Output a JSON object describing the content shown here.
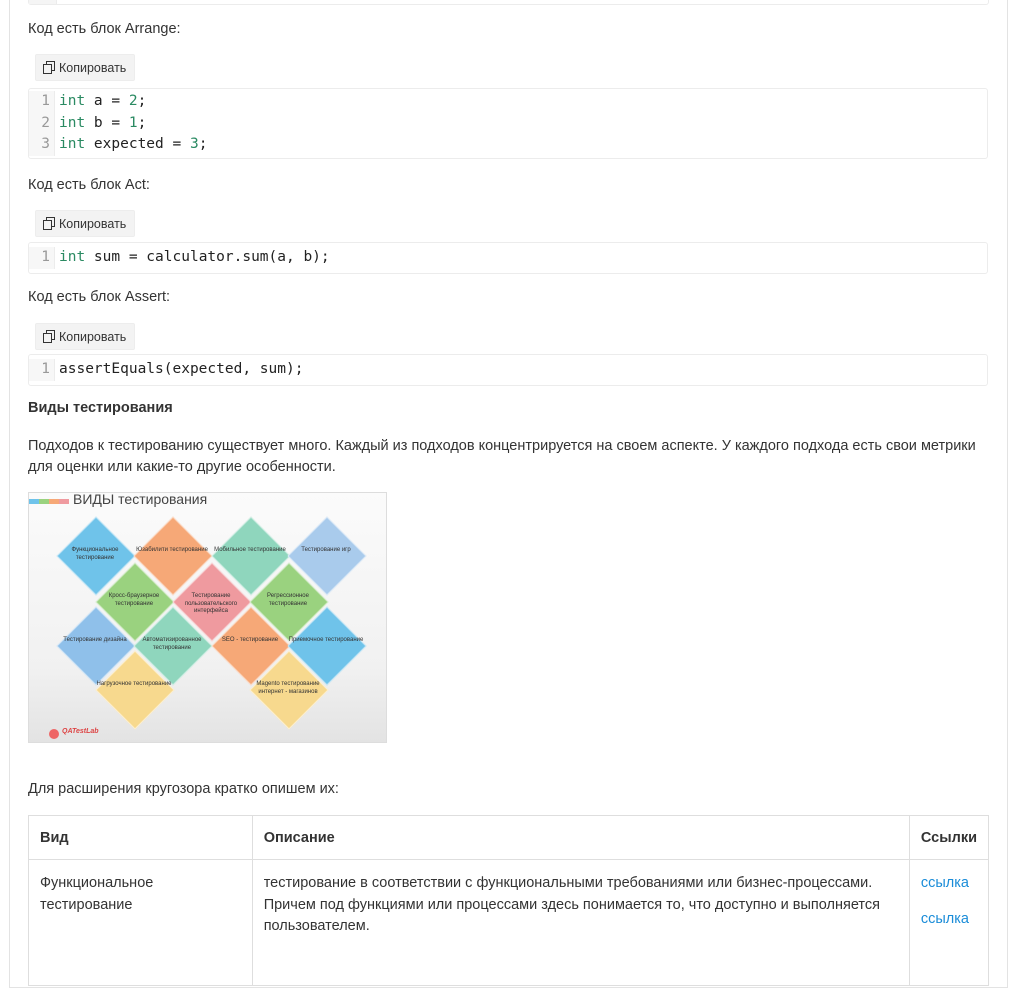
{
  "labels": {
    "arrange": "Код есть блок Arrange:",
    "act": "Код есть блок Act:",
    "assert": "Код есть блок Assert:",
    "copy": "Копировать"
  },
  "code_arrange": [
    {
      "n": "1",
      "kw": "int",
      "rest": " a = ",
      "num": "2",
      "end": ";"
    },
    {
      "n": "2",
      "kw": "int",
      "rest": " b = ",
      "num": "1",
      "end": ";"
    },
    {
      "n": "3",
      "kw": "int",
      "rest": " expected = ",
      "num": "3",
      "end": ";"
    }
  ],
  "code_act": [
    {
      "n": "1",
      "kw": "int",
      "rest": " sum = calculator.sum(a, b);"
    }
  ],
  "code_assert": [
    {
      "n": "1",
      "rest": "assertEquals(expected, sum);"
    }
  ],
  "section": {
    "heading": "Виды тестирования",
    "intro": "Подходов к тестированию существует много. Каждый из подходов концентрируется на своем аспекте. У каждого подхода есть свои метрики для оценки или какие-то другие особенности.",
    "outro": "Для расширения кругозора кратко опишем их:"
  },
  "image": {
    "title": "ВИДЫ тестирования",
    "logo": "QATestLab",
    "tiles": [
      "Функциональное тестирование",
      "Юзабилити тестирование",
      "Мобильное тестирование",
      "Тестирование игр",
      "Кросс-браузерное тестирование",
      "Тестирование пользовательского интерфейса",
      "Регрессионное тестирование",
      "Тестирование дизайна",
      "Автоматизированное тестирование",
      "SEO - тестирование",
      "Приемочное тестирование",
      "Нагрузочное тестирование",
      "Magento тестирование интернет - магазинов"
    ],
    "colors": [
      "#6fc3ea",
      "#f6a877",
      "#8fd6bd",
      "#a9cbec",
      "#9ad27f",
      "#ef9a9f",
      "#9ad27f",
      "#8fc0ea",
      "#8fd6bd",
      "#f6a877",
      "#6fc3ea",
      "#f7d98e",
      "#f7d98e"
    ]
  },
  "table": {
    "headers": [
      "Вид",
      "Описание",
      "Ссылки"
    ],
    "rows": [
      {
        "type": "Функциональное тестирование",
        "desc": "тестирование в соответствии с функциональными требованиями или бизнес-процессами. Причем под функциями или процессами здесь понимается то, что доступно и выполняется пользователем.",
        "links": [
          "ссылка",
          "ссылка"
        ]
      }
    ]
  }
}
